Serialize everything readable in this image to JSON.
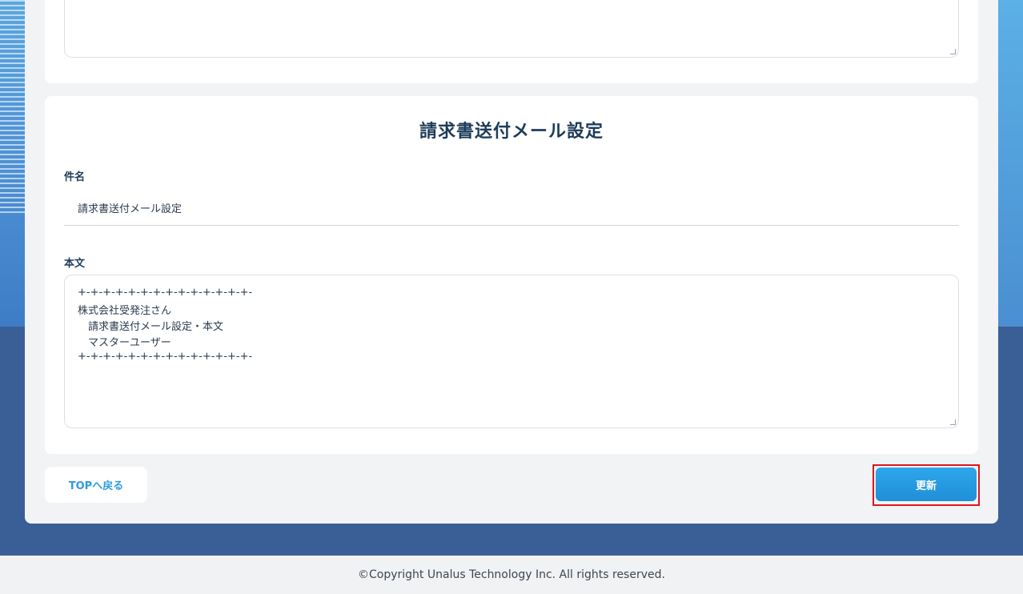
{
  "invoice_mail": {
    "section_title": "請求書送付メール設定",
    "subject_label": "件名",
    "subject_value": "請求書送付メール設定",
    "body_label": "本文",
    "body_lines": [
      "+-+-+-+-+-+-+-+-+-+-+-+-+-+-",
      "株式会社受発注さん",
      "　請求書送付メール設定・本文",
      "　マスターユーザー",
      "+-+-+-+-+-+-+-+-+-+-+-+-+-+-"
    ]
  },
  "actions": {
    "back_label": "TOPへ戻る",
    "update_label": "更新"
  },
  "footer": {
    "copyright": "©Copyright Unalus Technology Inc. All rights reserved."
  }
}
